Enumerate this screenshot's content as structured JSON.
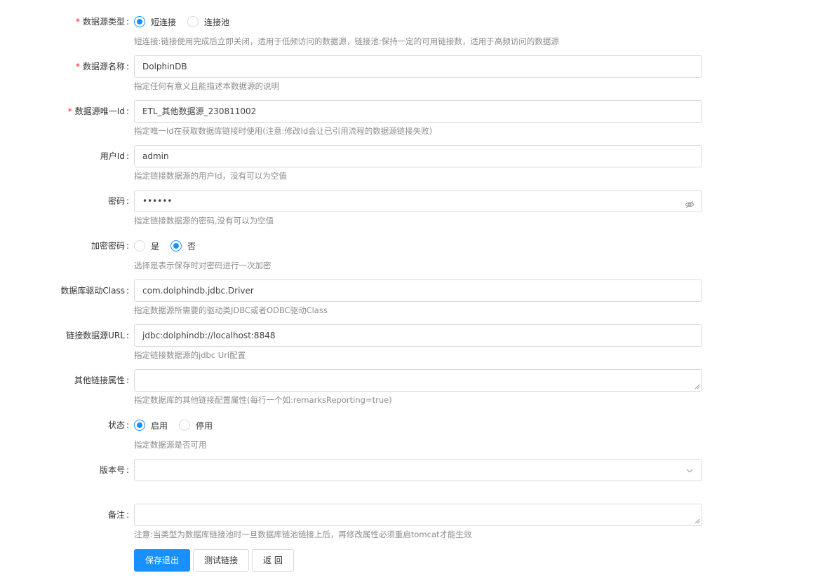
{
  "form": {
    "ds_type": {
      "label": "数据源类型",
      "options": [
        "短连接",
        "连接池"
      ],
      "selected": 0,
      "help": "短连接:链接使用完成后立即关闭，适用于低频访问的数据源，链接池:保持一定的可用链接数，适用于高频访问的数据源"
    },
    "ds_name": {
      "label": "数据源名称",
      "value": "DolphinDB",
      "help": "指定任何有意义且能描述本数据源的说明"
    },
    "ds_id": {
      "label": "数据源唯一Id",
      "value": "ETL_其他数据源_230811002",
      "help": "指定唯一Id在获取数据库链接时使用(注意:修改Id会让已引用流程的数据源链接失败)"
    },
    "user_id": {
      "label": "用户Id",
      "value": "admin",
      "help": "指定链接数据源的用户Id，没有可以为空值"
    },
    "password": {
      "label": "密码",
      "value": "••••••",
      "help": "指定链接数据源的密码,没有可以为空值"
    },
    "encrypt": {
      "label": "加密密码",
      "options": [
        "是",
        "否"
      ],
      "selected": 1,
      "help": "选择是表示保存时对密码进行一次加密"
    },
    "driver": {
      "label": "数据库驱动Class",
      "value": "com.dolphindb.jdbc.Driver",
      "help": "指定数据源所需要的驱动类JDBC或者ODBC驱动Class"
    },
    "url": {
      "label": "链接数据源URL",
      "value": "jdbc:dolphindb://localhost:8848",
      "help": "指定链接数据源的jdbc Url配置"
    },
    "props": {
      "label": "其他链接属性",
      "value": "",
      "help": "指定数据库的其他链接配置属性(每行一个如:remarksReporting=true)"
    },
    "status": {
      "label": "状态",
      "options": [
        "启用",
        "停用"
      ],
      "selected": 0,
      "help": "指定数据源是否可用"
    },
    "version": {
      "label": "版本号",
      "value": ""
    },
    "remark": {
      "label": "备注",
      "value": "",
      "help": "注意:当类型为数据库链接池时一旦数据库链池链接上后，再修改属性必须重启tomcat才能生效"
    }
  },
  "buttons": {
    "save": "保存退出",
    "test": "测试链接",
    "back": "返 回"
  },
  "colors": {
    "primary": "#1890ff",
    "required": "#f5222d",
    "help_text": "#8c8c8c",
    "border": "#d9d9d9"
  }
}
